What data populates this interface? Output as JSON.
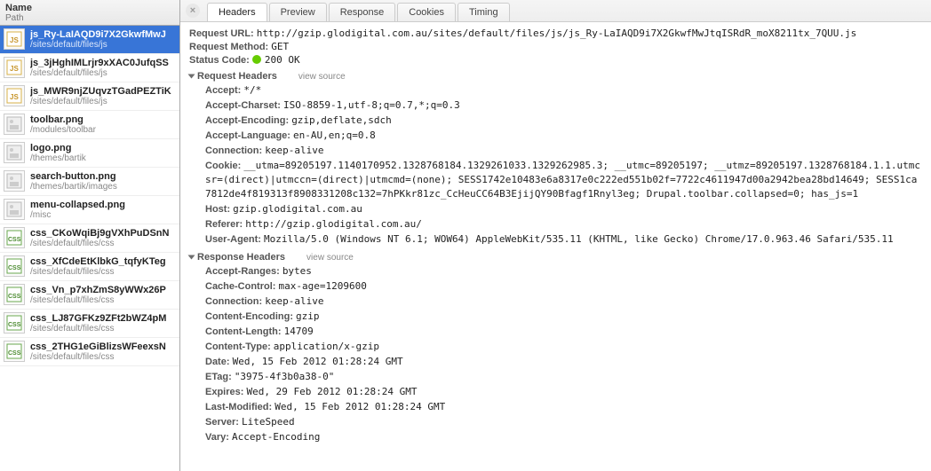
{
  "sidebar": {
    "header": {
      "name": "Name",
      "path": "Path"
    },
    "items": [
      {
        "name": "js_Ry-LaIAQD9i7X2GkwfMwJ",
        "path": "/sites/default/files/js",
        "type": "js",
        "selected": true
      },
      {
        "name": "js_3jHghIMLrjr9xXAC0JufqSS",
        "path": "/sites/default/files/js",
        "type": "js"
      },
      {
        "name": "js_MWR9njZUqvzTGadPEZTiK",
        "path": "/sites/default/files/js",
        "type": "js"
      },
      {
        "name": "toolbar.png",
        "path": "/modules/toolbar",
        "type": "png"
      },
      {
        "name": "logo.png",
        "path": "/themes/bartik",
        "type": "png"
      },
      {
        "name": "search-button.png",
        "path": "/themes/bartik/images",
        "type": "png"
      },
      {
        "name": "menu-collapsed.png",
        "path": "/misc",
        "type": "png"
      },
      {
        "name": "css_CKoWqiBj9gVXhPuDSnN",
        "path": "/sites/default/files/css",
        "type": "css"
      },
      {
        "name": "css_XfCdeEtKlbkG_tqfyKTeg",
        "path": "/sites/default/files/css",
        "type": "css"
      },
      {
        "name": "css_Vn_p7xhZmS8yWWx26P",
        "path": "/sites/default/files/css",
        "type": "css"
      },
      {
        "name": "css_LJ87GFKz9ZFt2bWZ4pM",
        "path": "/sites/default/files/css",
        "type": "css"
      },
      {
        "name": "css_2THG1eGiBlizsWFeexsN",
        "path": "/sites/default/files/css",
        "type": "css"
      }
    ]
  },
  "tabs": [
    {
      "label": "Headers",
      "active": true
    },
    {
      "label": "Preview"
    },
    {
      "label": "Response"
    },
    {
      "label": "Cookies"
    },
    {
      "label": "Timing"
    }
  ],
  "summary": {
    "request_url_label": "Request URL:",
    "request_url": "http://gzip.glodigital.com.au/sites/default/files/js/js_Ry-LaIAQD9i7X2GkwfMwJtqISRdR_moX8211tx_7QUU.js",
    "request_method_label": "Request Method:",
    "request_method": "GET",
    "status_code_label": "Status Code:",
    "status_code": "200 OK"
  },
  "sections": {
    "request_headers_title": "Request Headers",
    "response_headers_title": "Response Headers",
    "view_source": "view source"
  },
  "request_headers": [
    {
      "k": "Accept:",
      "v": "*/*"
    },
    {
      "k": "Accept-Charset:",
      "v": "ISO-8859-1,utf-8;q=0.7,*;q=0.3"
    },
    {
      "k": "Accept-Encoding:",
      "v": "gzip,deflate,sdch"
    },
    {
      "k": "Accept-Language:",
      "v": "en-AU,en;q=0.8"
    },
    {
      "k": "Connection:",
      "v": "keep-alive"
    },
    {
      "k": "Cookie:",
      "v": "__utma=89205197.1140170952.1328768184.1329261033.1329262985.3; __utmc=89205197; __utmz=89205197.1328768184.1.1.utmcsr=(direct)|utmccn=(direct)|utmcmd=(none); SESS1742e10483e6a8317e0c222ed551b02f=7722c4611947d00a2942bea28bd14649; SESS1ca7812de4f819313f8908331208c132=7hPKkr81zc_CcHeuCC64B3EjijQY90Bfagf1Rnyl3eg; Drupal.toolbar.collapsed=0; has_js=1"
    },
    {
      "k": "Host:",
      "v": "gzip.glodigital.com.au"
    },
    {
      "k": "Referer:",
      "v": "http://gzip.glodigital.com.au/"
    },
    {
      "k": "User-Agent:",
      "v": "Mozilla/5.0 (Windows NT 6.1; WOW64) AppleWebKit/535.11 (KHTML, like Gecko) Chrome/17.0.963.46 Safari/535.11"
    }
  ],
  "response_headers": [
    {
      "k": "Accept-Ranges:",
      "v": "bytes"
    },
    {
      "k": "Cache-Control:",
      "v": "max-age=1209600"
    },
    {
      "k": "Connection:",
      "v": "keep-alive"
    },
    {
      "k": "Content-Encoding:",
      "v": "gzip"
    },
    {
      "k": "Content-Length:",
      "v": "14709"
    },
    {
      "k": "Content-Type:",
      "v": "application/x-gzip"
    },
    {
      "k": "Date:",
      "v": "Wed, 15 Feb 2012 01:28:24 GMT"
    },
    {
      "k": "ETag:",
      "v": "\"3975-4f3b0a38-0\""
    },
    {
      "k": "Expires:",
      "v": "Wed, 29 Feb 2012 01:28:24 GMT"
    },
    {
      "k": "Last-Modified:",
      "v": "Wed, 15 Feb 2012 01:28:24 GMT"
    },
    {
      "k": "Server:",
      "v": "LiteSpeed"
    },
    {
      "k": "Vary:",
      "v": "Accept-Encoding"
    }
  ]
}
